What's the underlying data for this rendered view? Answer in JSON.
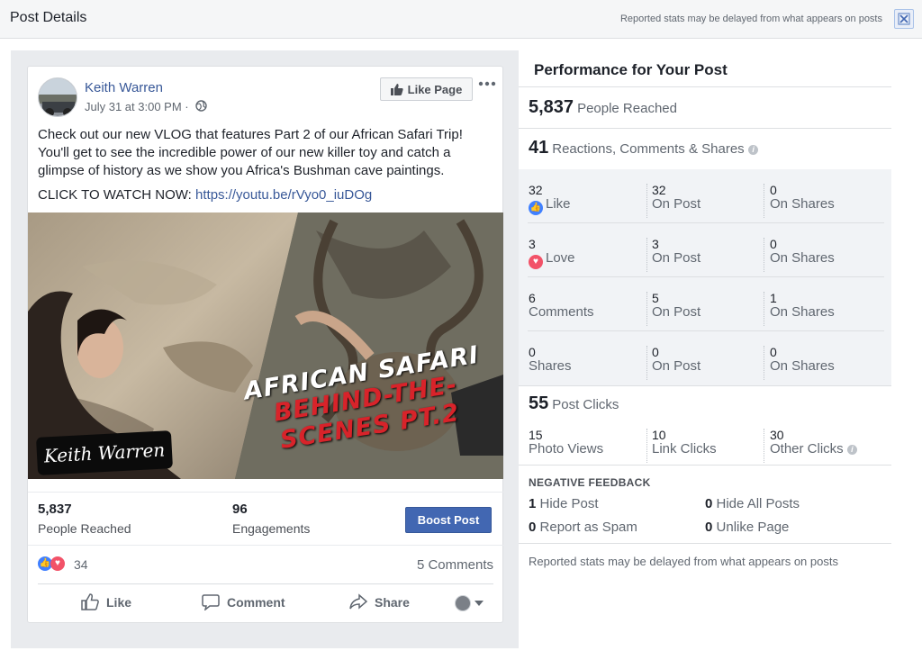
{
  "window": {
    "title": "Post Details",
    "delay_note": "Reported stats may be delayed from what appears on posts",
    "close_icon": "close-icon"
  },
  "post": {
    "author": "Keith Warren",
    "date": "July 31 at 3:00 PM ·",
    "like_page_label": "Like Page",
    "text_p1": "Check out our new VLOG that features Part 2 of our African Safari Trip! You'll get to see the incredible power of our new killer toy and catch a glimpse of history as we show you Africa's Bushman cave paintings.",
    "text_cta": "CLICK TO WATCH NOW: ",
    "link": "https://youtu.be/rVyo0_iuDOg",
    "image": {
      "title_line1": "AFRICAN SAFARI",
      "title_line2": "BEHIND-THE-SCENES PT.2",
      "signature": "Keith Warren"
    },
    "people_reached_num": "5,837",
    "people_reached_label": "People Reached",
    "engagements_num": "96",
    "engagements_label": "Engagements",
    "boost_label": "Boost Post",
    "reaction_count": "34",
    "comments_count": "5 Comments",
    "actions": {
      "like": "Like",
      "comment": "Comment",
      "share": "Share"
    }
  },
  "performance": {
    "title": "Performance for Your Post",
    "reached_num": "5,837",
    "reached_label": "People Reached",
    "rcs_num": "41",
    "rcs_label": "Reactions, Comments & Shares",
    "rows": [
      {
        "total": "32",
        "label": "Like",
        "on_post": "32",
        "on_post_label": "On Post",
        "on_shares": "0",
        "on_shares_label": "On Shares"
      },
      {
        "total": "3",
        "label": "Love",
        "on_post": "3",
        "on_post_label": "On Post",
        "on_shares": "0",
        "on_shares_label": "On Shares"
      },
      {
        "total": "6",
        "label": "Comments",
        "on_post": "5",
        "on_post_label": "On Post",
        "on_shares": "1",
        "on_shares_label": "On Shares"
      },
      {
        "total": "0",
        "label": "Shares",
        "on_post": "0",
        "on_post_label": "On Post",
        "on_shares": "0",
        "on_shares_label": "On Shares"
      }
    ],
    "clicks_num": "55",
    "clicks_label": "Post Clicks",
    "photo_views_num": "15",
    "photo_views_label": "Photo Views",
    "link_clicks_num": "10",
    "link_clicks_label": "Link Clicks",
    "other_clicks_num": "30",
    "other_clicks_label": "Other Clicks",
    "negative_title": "NEGATIVE FEEDBACK",
    "hide_post_num": "1",
    "hide_post_label": "Hide Post",
    "hide_all_num": "0",
    "hide_all_label": "Hide All Posts",
    "spam_num": "0",
    "spam_label": "Report as Spam",
    "unlike_num": "0",
    "unlike_label": "Unlike Page",
    "footer_note": "Reported stats may be delayed from what appears on posts"
  },
  "colors": {
    "brand": "#4267b2",
    "link": "#385898",
    "like": "#4080ff",
    "love": "#f25268"
  }
}
